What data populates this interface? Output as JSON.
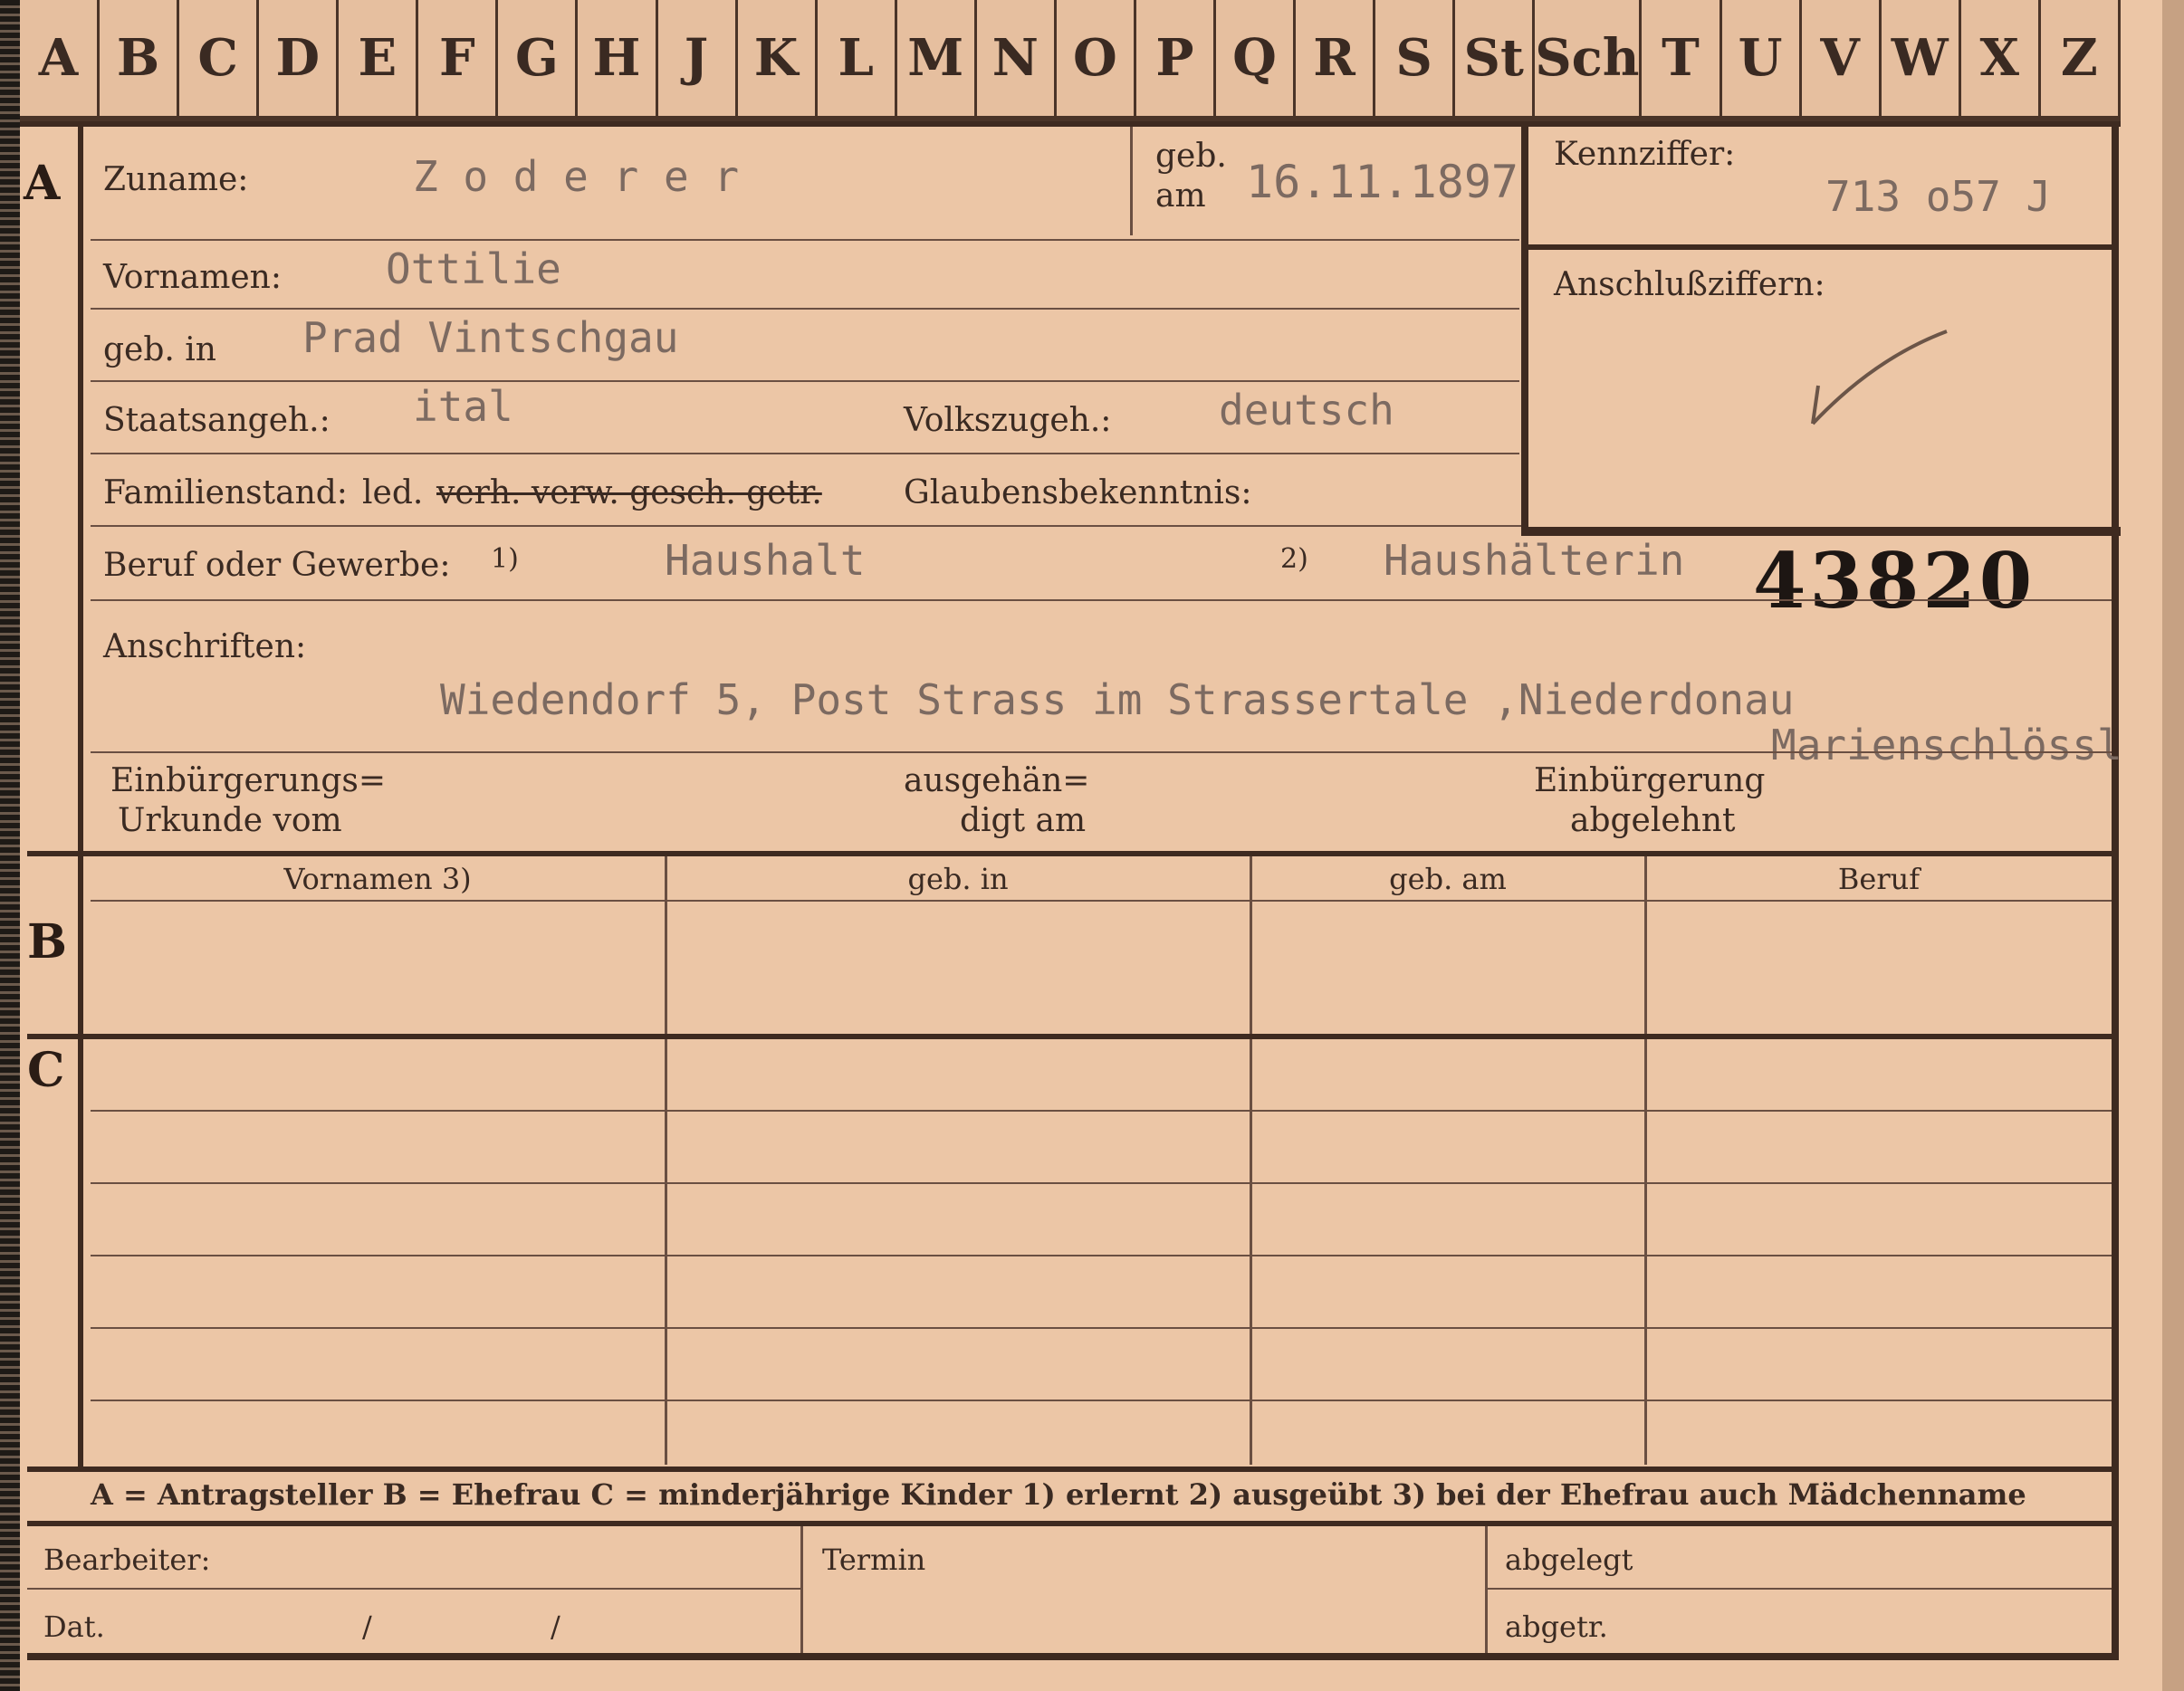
{
  "tabs": [
    "A",
    "B",
    "C",
    "D",
    "E",
    "F",
    "G",
    "H",
    "J",
    "K",
    "L",
    "M",
    "N",
    "O",
    "P",
    "Q",
    "R",
    "S",
    "St",
    "Sch",
    "T",
    "U",
    "V",
    "W",
    "X",
    "Z"
  ],
  "section_markers": {
    "a": "A",
    "b": "B",
    "c": "C"
  },
  "fields": {
    "zuname_label": "Zuname:",
    "zuname": "Z o d e r e r",
    "geb_am_label_1": "geb.",
    "geb_am_label_2": "am",
    "geb_am": "16.11.1897",
    "kennziffer_label": "Kennziffer:",
    "kennziffer": "713 o57  J",
    "vornamen_label": "Vornamen:",
    "vornamen": "Ottilie",
    "anschluss_label": "Anschlußziffern:",
    "geb_in_label": "geb. in",
    "geb_in": "Prad Vintschgau",
    "staatsangeh_label": "Staatsangeh.:",
    "staatsangeh": "ital",
    "volkszugeh_label": "Volkszugeh.:",
    "volkszugeh": "deutsch",
    "familienstand_label": "Familienstand:",
    "familienstand_options": "led.",
    "familienstand_struck": "verh. verw. gesch. getr.",
    "glaubens_label": "Glaubensbekenntnis:",
    "beruf_label": "Beruf oder Gewerbe:",
    "beruf_mark1": "1)",
    "beruf_erlernt": "Haushalt",
    "beruf_mark2": "2)",
    "beruf_ausgeuebt": "Haushälterin",
    "stamp_number": "43820",
    "anschriften_label": "Anschriften:",
    "anschrift_1": "Wiedendorf 5, Post Strass im Strassertale ,Niederdonau",
    "anschrift_2": "Marienschlössl",
    "einb_urkunde_1": "Einbürgerungs=",
    "einb_urkunde_2": "Urkunde vom",
    "ausgehaendigt_1": "ausgehän=",
    "ausgehaendigt_2": "digt am",
    "einb_abgelehnt_1": "Einbürgerung",
    "einb_abgelehnt_2": "abgelehnt"
  },
  "table": {
    "headers": [
      "Vornamen 3)",
      "geb. in",
      "geb. am",
      "Beruf"
    ]
  },
  "legend": "A = Antragsteller   B = Ehefrau   C = minderjährige Kinder   1) erlernt   2) ausgeübt   3) bei der Ehefrau auch Mädchenname",
  "footer": {
    "bearbeiter": "Bearbeiter:",
    "dat": "Dat.",
    "slash1": "/",
    "slash2": "/",
    "termin": "Termin",
    "abgelegt": "abgelegt",
    "abgetr": "abgetr."
  }
}
